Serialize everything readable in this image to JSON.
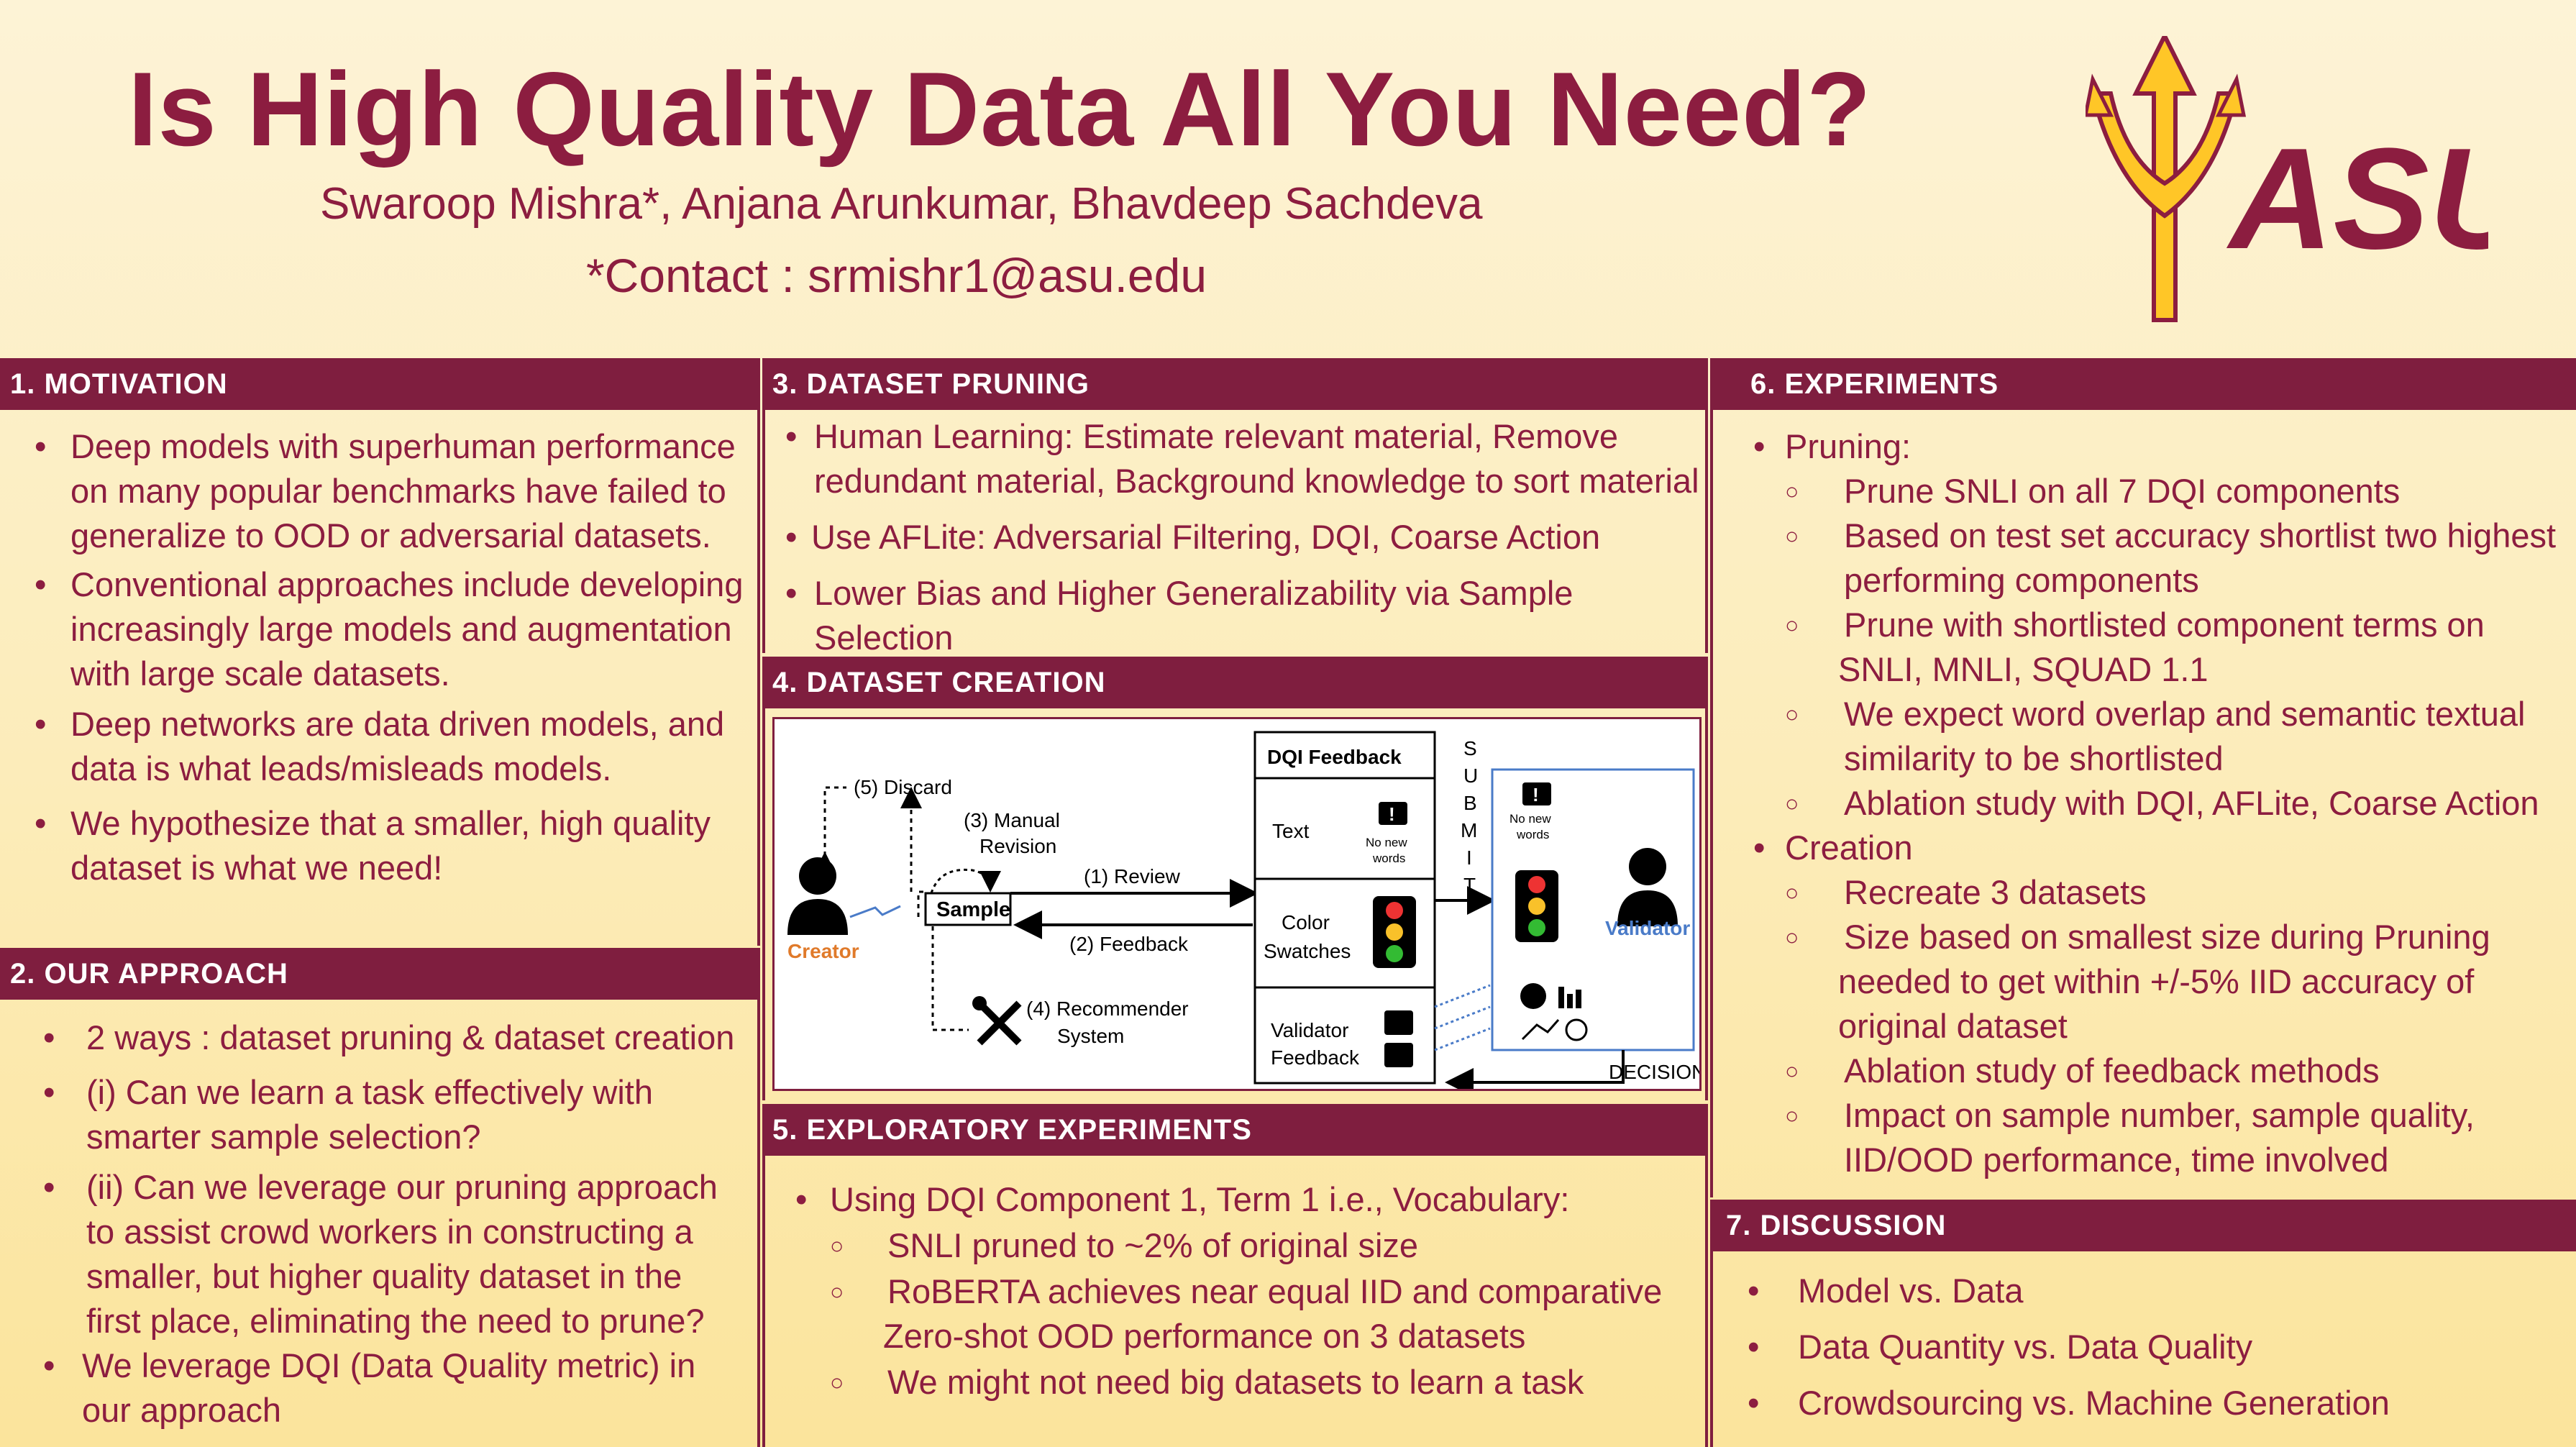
{
  "header": {
    "title": "Is High Quality Data All You Need?",
    "authors": "Swaroop Mishra*, Anjana Arunkumar, Bhavdeep Sachdeva",
    "contact": "*Contact : srmishr1@asu.edu",
    "logo_text": "ASU"
  },
  "colors": {
    "maroon": "#8c1d40",
    "gold": "#ffc627",
    "bar": "#7f1e3f"
  },
  "motivation": {
    "heading": "1. MOTIVATION",
    "bullets": [
      [
        "Deep models with superhuman performance",
        "on many popular benchmarks have failed to",
        "generalize to OOD or adversarial datasets."
      ],
      [
        "Conventional approaches include developing",
        "increasingly large models and augmentation",
        "with large scale datasets."
      ],
      [
        "Deep networks are data driven models, and",
        "data is what leads/misleads models."
      ],
      [
        "We hypothesize that a smaller, high quality",
        "dataset is what we need!"
      ]
    ]
  },
  "approach": {
    "heading": "2. OUR APPROACH",
    "bullets": [
      [
        "2 ways : dataset pruning & dataset creation"
      ],
      [
        "(i) Can we learn a task effectively with",
        "smarter sample selection?"
      ],
      [
        "(ii) Can we leverage our pruning approach",
        "to assist crowd workers in constructing a",
        "smaller, but higher quality dataset in the",
        "first place, eliminating the need to prune?"
      ],
      [
        "We leverage DQI (Data Quality metric) in",
        "our approach"
      ]
    ]
  },
  "pruning": {
    "heading": "3. DATASET PRUNING",
    "bullets": [
      [
        "Human Learning: Estimate relevant material, Remove",
        "redundant material, Background knowledge to sort material"
      ],
      [
        "Use AFLite: Adversarial Filtering, DQI, Coarse Action"
      ],
      [
        "Lower Bias and Higher Generalizability via Sample Selection"
      ]
    ]
  },
  "creation": {
    "heading": "4. DATASET CREATION",
    "diagram": {
      "discard": "(5) Discard",
      "manual": "(3) Manual",
      "revision": "Revision",
      "review": "(1) Review",
      "feedback": "(2) Feedback",
      "sample": "Sample",
      "creator": "Creator",
      "recommender1": "(4) Recommender",
      "recommender2": "System",
      "dqi_feedback": "DQI Feedback",
      "text": "Text",
      "color1": "Color",
      "color2": "Swatches",
      "validator_fb1": "Validator",
      "validator_fb2": "Feedback",
      "no_new1": "No new",
      "no_new2": "words",
      "submit": [
        "S",
        "U",
        "B",
        "M",
        "I",
        "T"
      ],
      "validator": "Validator",
      "decision": "DECISION"
    }
  },
  "exploratory": {
    "heading": "5. EXPLORATORY EXPERIMENTS",
    "main": "Using DQI Component 1, Term 1 i.e.,  Vocabulary:",
    "sub": [
      [
        "SNLI pruned to ~2% of original size"
      ],
      [
        "RoBERTA achieves near equal IID and comparative",
        "Zero-shot OOD performance on 3 datasets"
      ],
      [
        "We might not need big datasets to learn a task"
      ]
    ]
  },
  "experiments": {
    "heading": "6. EXPERIMENTS",
    "pruning_label": "Pruning:",
    "pruning_sub": [
      [
        "Prune SNLI on all 7 DQI components"
      ],
      [
        "Based on test set accuracy shortlist two highest",
        "performing components"
      ],
      [
        "Prune with shortlisted component terms on",
        "SNLI, MNLI, SQUAD 1.1"
      ],
      [
        "We expect word overlap and semantic textual",
        "similarity to be shortlisted"
      ],
      [
        "Ablation study with DQI, AFLite, Coarse Action"
      ]
    ],
    "creation_label": "Creation",
    "creation_sub": [
      [
        "Recreate 3 datasets"
      ],
      [
        "Size based on smallest size during Pruning",
        "needed to get within +/-5% IID accuracy of",
        "original dataset"
      ],
      [
        "Ablation study of feedback methods"
      ],
      [
        "Impact on sample number, sample quality,",
        "IID/OOD performance, time involved"
      ]
    ]
  },
  "discussion": {
    "heading": "7.  DISCUSSION",
    "bullets": [
      [
        "Model vs. Data"
      ],
      [
        "Data Quantity vs. Data Quality"
      ],
      [
        "Crowdsourcing vs. Machine Generation"
      ]
    ]
  }
}
